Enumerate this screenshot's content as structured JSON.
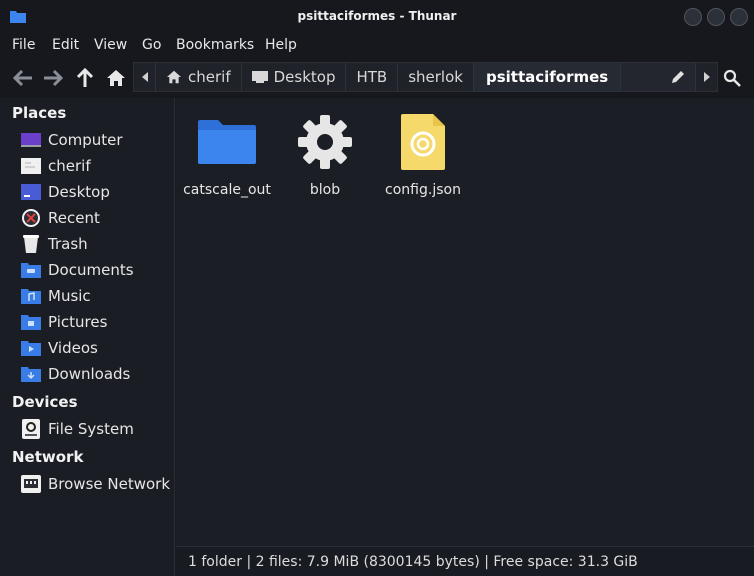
{
  "window": {
    "title": "psittaciformes - Thunar"
  },
  "menu": [
    "File",
    "Edit",
    "View",
    "Go",
    "Bookmarks",
    "Help"
  ],
  "toolbar": {
    "icons": [
      "back-icon",
      "forward-icon",
      "up-icon",
      "home-icon"
    ]
  },
  "pathbar": {
    "segments": [
      "cherif",
      "Desktop",
      "HTB",
      "sherlok",
      "psittaciformes"
    ]
  },
  "sidebar": {
    "places_header": "Places",
    "places": [
      {
        "label": "Computer",
        "icon": "computer-icon"
      },
      {
        "label": "cherif",
        "icon": "home-folder-icon"
      },
      {
        "label": "Desktop",
        "icon": "desktop-icon"
      },
      {
        "label": "Recent",
        "icon": "recent-icon"
      },
      {
        "label": "Trash",
        "icon": "trash-icon"
      },
      {
        "label": "Documents",
        "icon": "documents-folder-icon"
      },
      {
        "label": "Music",
        "icon": "music-folder-icon"
      },
      {
        "label": "Pictures",
        "icon": "pictures-folder-icon"
      },
      {
        "label": "Videos",
        "icon": "videos-folder-icon"
      },
      {
        "label": "Downloads",
        "icon": "downloads-folder-icon"
      }
    ],
    "devices_header": "Devices",
    "devices": [
      {
        "label": "File System",
        "icon": "drive-icon"
      }
    ],
    "network_header": "Network",
    "network": [
      {
        "label": "Browse Network",
        "icon": "network-icon"
      }
    ]
  },
  "files": [
    {
      "name": "catscale_out",
      "icon": "folder-icon"
    },
    {
      "name": "blob",
      "icon": "gear-file-icon"
    },
    {
      "name": "config.json",
      "icon": "json-file-icon"
    }
  ],
  "status": "1 folder  |  2 files: 7.9 MiB (8300145 bytes)  |  Free space: 31.3 GiB",
  "colors": {
    "accent_folder": "#3a7ce6",
    "background": "#1b1e24"
  }
}
